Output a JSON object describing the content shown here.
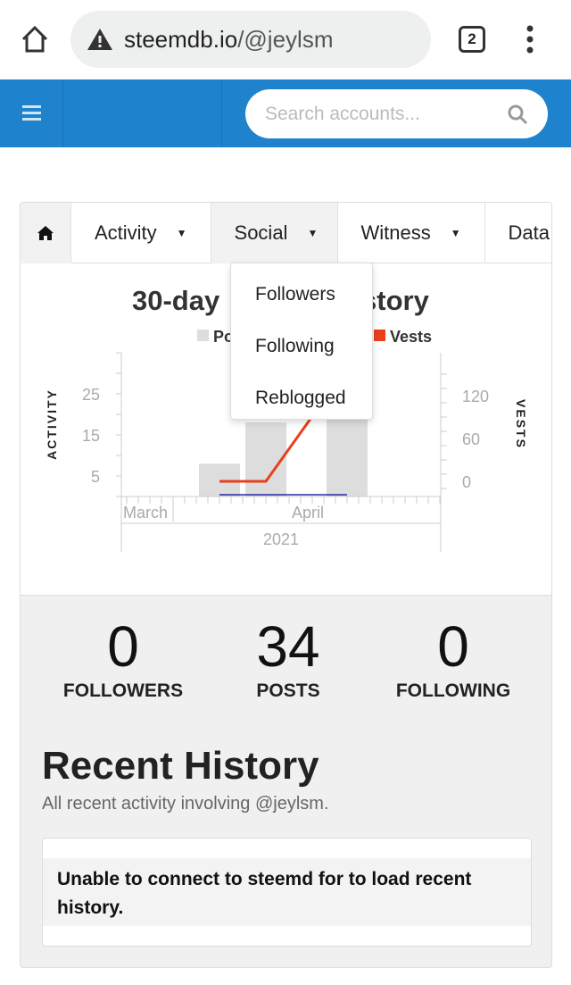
{
  "browser": {
    "url_domain": "steemdb.io",
    "url_path": "/@jeylsm",
    "tab_count": "2"
  },
  "navbar": {
    "search_placeholder": "Search accounts..."
  },
  "menu": {
    "items": [
      {
        "label": "Activity"
      },
      {
        "label": "Social"
      },
      {
        "label": "Witness"
      },
      {
        "label": "Data"
      }
    ]
  },
  "dropdown": {
    "items": [
      "Followers",
      "Following",
      "Reblogged"
    ]
  },
  "chart_data": {
    "type": "bar",
    "title_left": "30-day",
    "title_right": "story",
    "legend": [
      {
        "name": "Po",
        "color": "#dddddd"
      },
      {
        "name": "Vests",
        "color": "#e8401c"
      }
    ],
    "ylabel": "ACTIVITY",
    "y2label": "VESTS",
    "y_ticks": [
      5,
      15,
      25
    ],
    "y2_ticks": [
      0,
      60,
      120
    ],
    "x_month_labels": [
      "March",
      "April"
    ],
    "x_year_label": "2021",
    "categories": [
      "2021-04-05",
      "2021-04-09",
      "2021-04-16"
    ],
    "bars": [
      8,
      18,
      20
    ],
    "vests": [
      {
        "x": "2021-04-05",
        "y": 0
      },
      {
        "x": "2021-04-09",
        "y": 0
      },
      {
        "x": "2021-04-13",
        "y": 91
      }
    ],
    "other_line": {
      "color": "#2a2aa8",
      "values": [
        0,
        0
      ]
    }
  },
  "stats": [
    {
      "value": "0",
      "label": "FOLLOWERS"
    },
    {
      "value": "34",
      "label": "POSTS"
    },
    {
      "value": "0",
      "label": "FOLLOWING"
    }
  ],
  "recent": {
    "title": "Recent History",
    "subtitle": "All recent activity involving @jeylsm.",
    "message": "Unable to connect to steemd for to load recent history."
  }
}
